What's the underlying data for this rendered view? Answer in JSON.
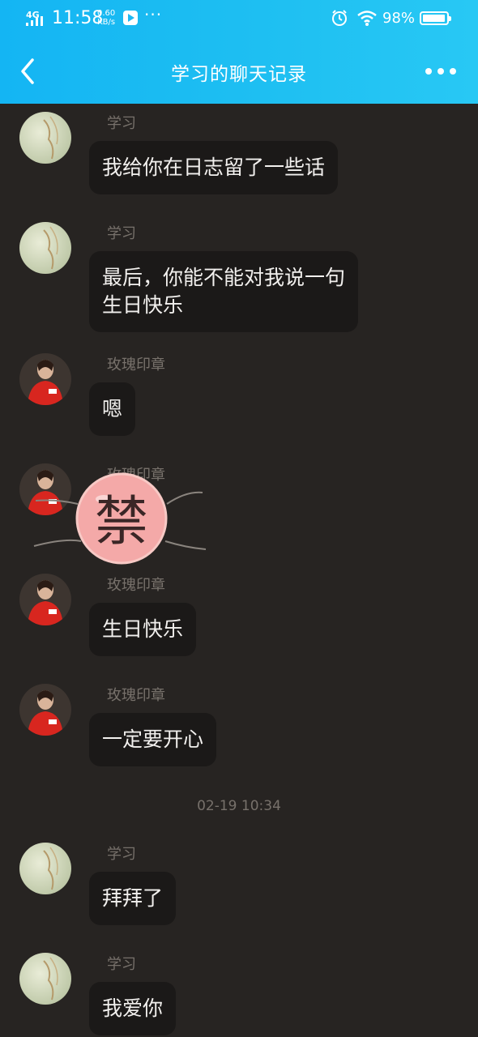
{
  "status_bar": {
    "network": "4G",
    "time": "11:58",
    "speed_value": "0.60",
    "speed_unit": "KB/s",
    "battery": "98%"
  },
  "header": {
    "title": "学习的聊天记录"
  },
  "messages": [
    {
      "sender": "学习",
      "text": "我给你在日志留了一些话"
    },
    {
      "sender": "学习",
      "text": "最后，你能不能对我说一句\n生日快乐"
    },
    {
      "sender": "玫瑰印章",
      "text": "嗯"
    },
    {
      "sender": "玫瑰印章",
      "sticker_text": "禁"
    },
    {
      "sender": "玫瑰印章",
      "text": "生日快乐"
    },
    {
      "sender": "玫瑰印章",
      "text": "一定要开心"
    },
    {
      "sender": "学习",
      "text": "拜拜了"
    },
    {
      "sender": "学习",
      "text": "我爱你"
    }
  ],
  "timestamp": "02-19 10:34",
  "colors": {
    "header_bg": "#1fc0f2",
    "chat_bg": "#272422",
    "bubble_bg": "#1b1918",
    "sticker_pink": "#f4a9a8"
  }
}
